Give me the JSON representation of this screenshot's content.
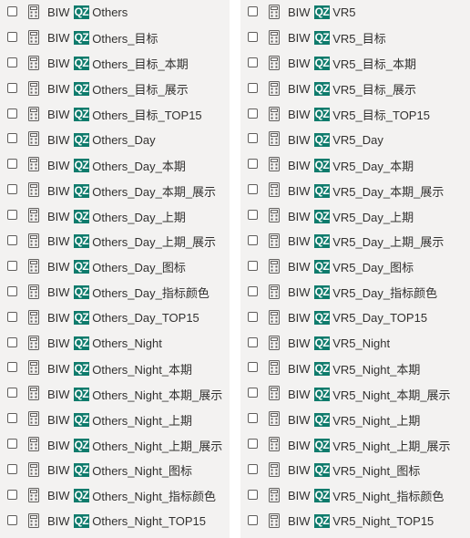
{
  "prefix": "BIW",
  "tag": "QZ",
  "left_items": [
    "Others",
    "Others_目标",
    "Others_目标_本期",
    "Others_目标_展示",
    "Others_目标_TOP15",
    "Others_Day",
    "Others_Day_本期",
    "Others_Day_本期_展示",
    "Others_Day_上期",
    "Others_Day_上期_展示",
    "Others_Day_图标",
    "Others_Day_指标颜色",
    "Others_Day_TOP15",
    "Others_Night",
    "Others_Night_本期",
    "Others_Night_本期_展示",
    "Others_Night_上期",
    "Others_Night_上期_展示",
    "Others_Night_图标",
    "Others_Night_指标颜色",
    "Others_Night_TOP15"
  ],
  "right_items": [
    "VR5",
    "VR5_目标",
    "VR5_目标_本期",
    "VR5_目标_展示",
    "VR5_目标_TOP15",
    "VR5_Day",
    "VR5_Day_本期",
    "VR5_Day_本期_展示",
    "VR5_Day_上期",
    "VR5_Day_上期_展示",
    "VR5_Day_图标",
    "VR5_Day_指标颜色",
    "VR5_Day_TOP15",
    "VR5_Night",
    "VR5_Night_本期",
    "VR5_Night_本期_展示",
    "VR5_Night_上期",
    "VR5_Night_上期_展示",
    "VR5_Night_图标",
    "VR5_Night_指标颜色",
    "VR5_Night_TOP15"
  ],
  "row_icon": "calculator-icon",
  "colors": {
    "tag_bg": "#0f7b6c",
    "panel_bg": "#f3f2f1",
    "text": "#323130"
  }
}
